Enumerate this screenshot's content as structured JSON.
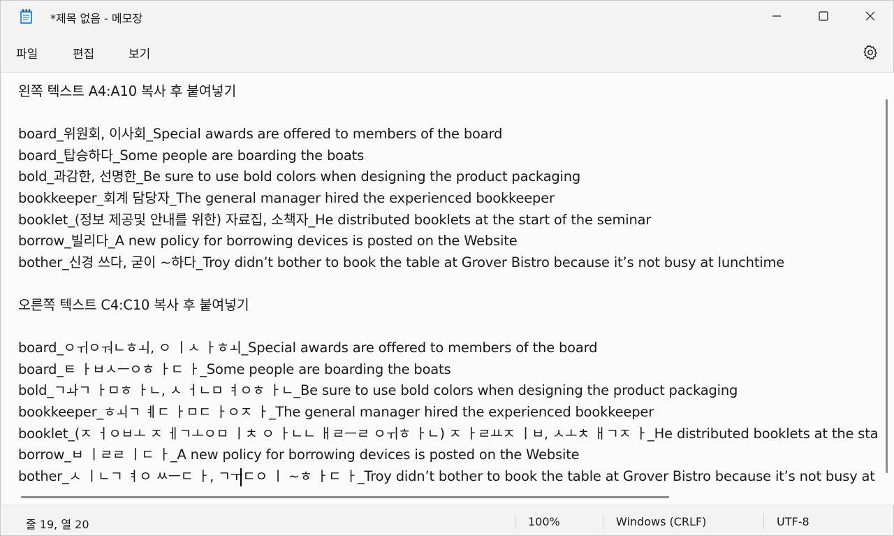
{
  "window": {
    "title": "*제목 없음 - 메모장"
  },
  "menu": {
    "file": "파일",
    "edit": "편집",
    "view": "보기"
  },
  "editor": {
    "lines": [
      "왼쪽 텍스트 A4:A10 복사 후 붙여넣기",
      "",
      "board_위원회, 이사회_Special awards are offered to members of the board",
      "board_탑승하다_Some people are boarding the boats",
      "bold_과감한, 선명한_Be sure to use bold colors when designing the product packaging",
      "bookkeeper_회계 담당자_The general manager hired the experienced bookkeeper",
      "booklet_(정보 제공및 안내를 위한) 자료집, 소책자_He distributed booklets at the start of the seminar",
      "borrow_빌리다_A new policy for borrowing devices is posted on the Website",
      "bother_신경 쓰다, 굳이 ~하다_Troy didn’t bother to book the table at Grover Bistro because it’s not busy at lunchtime",
      "",
      "오른쪽 텍스트 C4:C10 복사 후 붙여넣기",
      "",
      "board_ㅇㅟㅇㅝㄴㅎㅚ, ㅇ ㅣㅅ ㅏㅎㅚ_Special awards are offered to members of the board",
      "board_ㅌ ㅏㅂㅅㅡㅇㅎ ㅏㄷ ㅏ_Some people are boarding the boats",
      "bold_ㄱㅘㄱ ㅏㅁㅎ ㅏㄴ, ㅅ ㅓㄴㅁ ㅕㅇㅎ ㅏㄴ_Be sure to use bold colors when designing the product packaging",
      "bookkeeper_ㅎㅚㄱ ㅖㄷ ㅏㅁㄷ ㅏㅇㅈ ㅏ_The general manager hired the experienced bookkeeper",
      "booklet_(ㅈ ㅓㅇㅂㅗ ㅈ ㅔㄱㅗㅇㅁ ㅣㅊ ㅇ ㅏㄴㄴ ㅐㄹㅡㄹ ㅇㅟㅎ ㅏㄴ) ㅈ ㅏㄹㅛㅈ ㅣㅂ, ㅅㅗㅊ ㅐㄱㅈ ㅏ_He distributed booklets at the start of the seminar",
      "borrow_ㅂ ㅣㄹㄹ ㅣㄷ ㅏ_A new policy for borrowing devices is posted on the Website",
      "bother_ㅅ ㅣㄴㄱ ㅕㅇ ㅆㅡㄷ ㅏ, ㄱㅜㄷㅇ ㅣ ~ㅎ ㅏㄷ ㅏ_Troy didn’t bother to book the table at Grover Bistro because it’s not busy at lunchtime"
    ]
  },
  "status": {
    "position": "줄 19, 열 20",
    "zoom": "100%",
    "line_ending": "Windows (CRLF)",
    "encoding": "UTF-8"
  }
}
